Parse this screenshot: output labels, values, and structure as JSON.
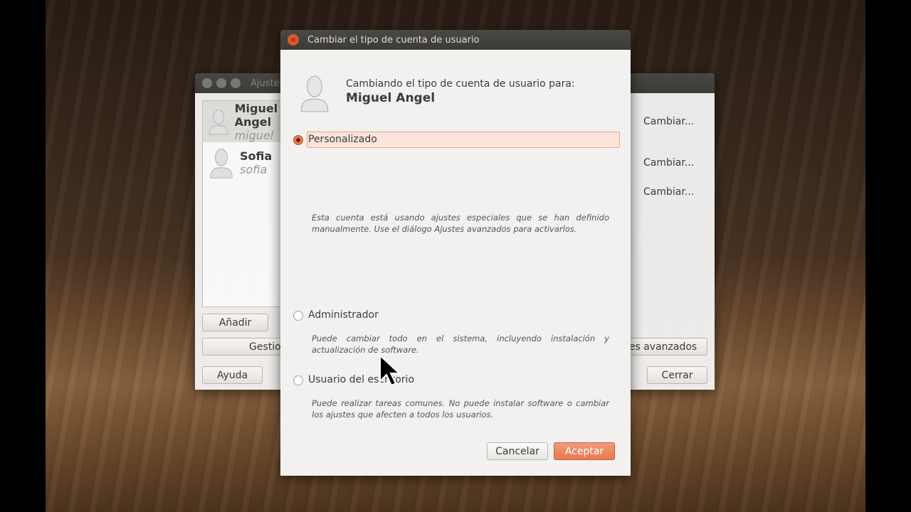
{
  "background_window": {
    "title": "Ajustes",
    "users": [
      {
        "name": "Miguel Angel",
        "login": "miguel"
      },
      {
        "name": "Sofia",
        "login": "sofia"
      }
    ],
    "change_links": [
      "Cambiar...",
      "Cambiar...",
      "Cambiar..."
    ],
    "buttons": {
      "add": "Añadir",
      "manage": "Gestionar",
      "help": "Ayuda",
      "advanced": "Ajustes avanzados",
      "close": "Cerrar"
    }
  },
  "dialog": {
    "title": "Cambiar el tipo de cuenta de usuario",
    "heading": "Cambiando el tipo de cuenta de usuario para:",
    "user": "Miguel Angel",
    "options": [
      {
        "label": "Personalizado",
        "selected": true,
        "description": "Esta cuenta está usando ajustes especiales que se han definido manualmente. Use el diálogo Ajustes avanzados para activarlos."
      },
      {
        "label": "Administrador",
        "selected": false,
        "description": "Puede cambiar todo en el sistema, incluyendo instalación y actualización de software."
      },
      {
        "label": "Usuario del escritorio",
        "selected": false,
        "description": "Puede realizar tareas comunes. No puede instalar software o cambiar los ajustes que afecten a todos los usuarios."
      }
    ],
    "cancel": "Cancelar",
    "accept": "Aceptar"
  },
  "colors": {
    "accent": "#e9784e",
    "titlebar": "#3c3b37",
    "window": "#f2f1f0"
  }
}
